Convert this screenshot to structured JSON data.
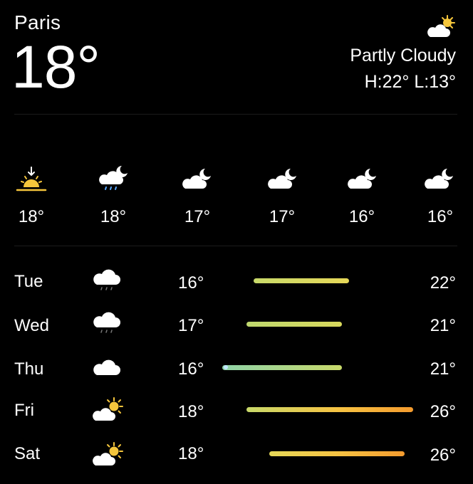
{
  "header": {
    "city": "Paris",
    "temperature": "18°",
    "condition": "Partly Cloudy",
    "high_low": "H:22° L:13°",
    "condition_icon": "partly-cloudy-day-icon"
  },
  "hourly": [
    {
      "icon": "sunset-icon",
      "temp": "18°"
    },
    {
      "icon": "cloud-moon-rain-icon",
      "temp": "18°"
    },
    {
      "icon": "cloud-moon-icon",
      "temp": "17°"
    },
    {
      "icon": "cloud-moon-icon",
      "temp": "17°"
    },
    {
      "icon": "cloud-moon-icon",
      "temp": "16°"
    },
    {
      "icon": "cloud-moon-icon",
      "temp": "16°"
    }
  ],
  "daily": [
    {
      "day": "Tue",
      "icon": "cloud-rain-icon",
      "low": "16°",
      "high": "22°"
    },
    {
      "day": "Wed",
      "icon": "cloud-rain-icon",
      "low": "17°",
      "high": "21°"
    },
    {
      "day": "Thu",
      "icon": "cloud-icon",
      "low": "16°",
      "high": "21°"
    },
    {
      "day": "Fri",
      "icon": "partly-cloudy-day-icon",
      "low": "18°",
      "high": "26°"
    },
    {
      "day": "Sat",
      "icon": "partly-cloudy-day-icon",
      "low": "18°",
      "high": "26°"
    }
  ],
  "colors": {
    "background": "#000000",
    "sun": "#F5C63C",
    "bar_cool": "#8FD3A8",
    "bar_mild": "#C8D96A",
    "bar_warm": "#F6C343",
    "bar_hot": "#F49B2E"
  }
}
